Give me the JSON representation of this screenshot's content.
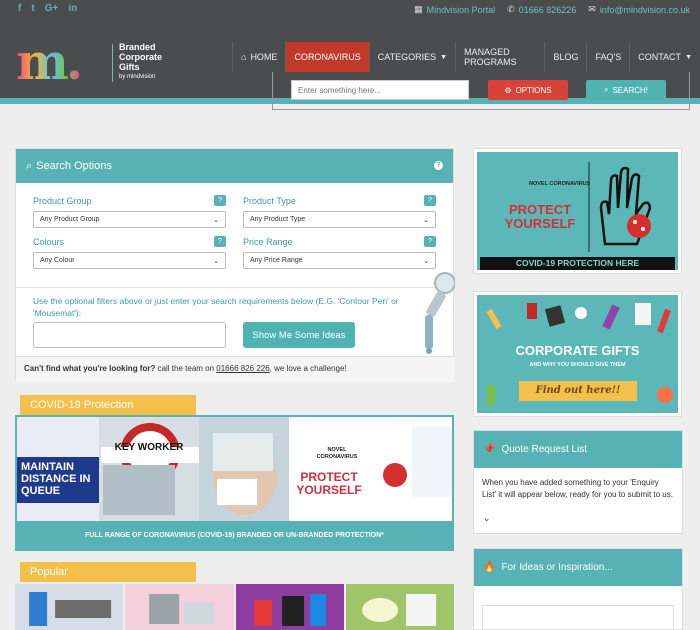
{
  "topbar": {
    "social": [
      "f",
      "t",
      "G+",
      "in"
    ],
    "portal_label": "Mindvision Portal",
    "phone": "01666 826226",
    "email": "info@mindvision.co.uk"
  },
  "logo": {
    "mark": "m.",
    "text_line1": "Branded",
    "text_line2": "Corporate",
    "text_line3": "Gifts",
    "by": "by mindvision"
  },
  "nav": {
    "items": [
      {
        "label": "HOME",
        "icon": "home-icon"
      },
      {
        "label": "CORONAVIRUS"
      },
      {
        "label": "CATEGORIES",
        "caret": true
      },
      {
        "label": "MANAGED PROGRAMS"
      },
      {
        "label": "BLOG"
      },
      {
        "label": "FAQ'S"
      },
      {
        "label": "CONTACT",
        "caret": true
      }
    ]
  },
  "search": {
    "placeholder": "Enter something here...",
    "options_label": "OPTIONS",
    "search_label": "SEARCH!"
  },
  "search_options": {
    "title": "Search Options",
    "product_group_label": "Product Group",
    "product_group_value": "Any Product Group",
    "product_type_label": "Product Type",
    "product_type_value": "Any Product Type",
    "colours_label": "Colours",
    "colours_value": "Any Colour",
    "price_range_label": "Price Range",
    "price_range_value": "Any Price Range",
    "hint": "Use the optional filters above or just enter your search requirements below (E.G. 'Contour Pen' or 'Mousemat'):",
    "ideas_button": "Show Me Some Ideas",
    "call_bold": "Can't find what you're looking for?",
    "call_mid": " call the team on ",
    "call_phone": "01666 826 226",
    "call_end": ", we love a challenge!"
  },
  "sections": {
    "covid_tag": "COVID-19 Protection",
    "covid_caption": "FULL RANGE OF CORONAVIRUS (COVID-19) BRANDED OR UN-BRANDED PROTECTION*",
    "covid_banner_novel": "NOVEL CORONAVIRUS",
    "covid_banner_protect": "PROTECT YOURSELF",
    "covid_banner_maintain": "MAINTAIN DISTANCE IN QUEUE",
    "covid_banner_keyworker": "KEY WORKER",
    "popular_tag": "Popular"
  },
  "sidebar": {
    "protect_novel": "NOVEL CORONAVIRUS",
    "protect_title": "PROTECT YOURSELF",
    "protect_footer": "COVID-19 PROTECTION HERE",
    "cg_title": "CORPORATE GIFTS",
    "cg_sub": "AND WHY YOU SHOULD GIVE THEM",
    "cg_ribbon": "Find out here!!",
    "quote_title": "Quote Request List",
    "quote_body": "When you have added something to your 'Enquiry List' it will appear below, ready for you to submit to us.",
    "ideas_title": "For Ideas or Inspiration..."
  },
  "colors": {
    "teal": "#57b2b5",
    "header": "#4a4c4e",
    "accent_red": "#c0392b",
    "tag_yellow": "#f2c04b"
  }
}
